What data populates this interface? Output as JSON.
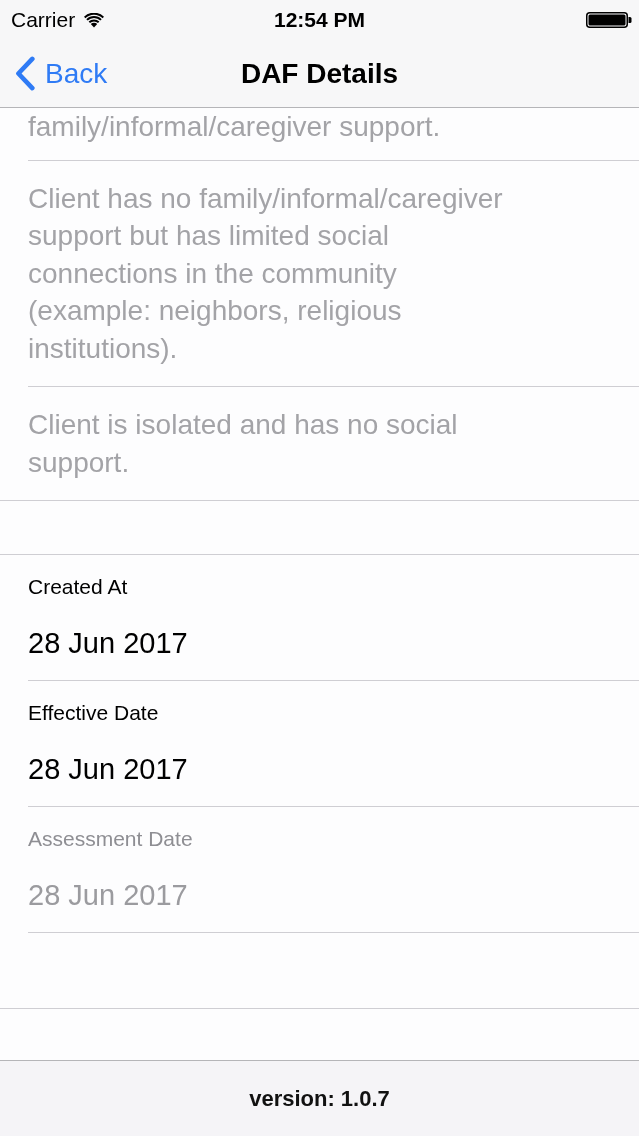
{
  "status_bar": {
    "carrier": "Carrier",
    "time": "12:54 PM"
  },
  "nav_bar": {
    "back_label": "Back",
    "title": "DAF Details"
  },
  "options": [
    {
      "text": "family/informal/caregiver support.",
      "disabled": true
    },
    {
      "text": "Client has no family/informal/caregiver support but has limited social connections in the community (example: neighbors, religious institutions).",
      "disabled": true
    },
    {
      "text": "Client is isolated and has no social support.",
      "disabled": true
    }
  ],
  "fields": [
    {
      "label": "Created At",
      "value": "28 Jun 2017",
      "disabled": false
    },
    {
      "label": "Effective Date",
      "value": "28 Jun 2017",
      "disabled": false
    },
    {
      "label": "Assessment Date",
      "value": "28 Jun 2017",
      "disabled": true
    }
  ],
  "footer": {
    "version": "version: 1.0.7"
  }
}
